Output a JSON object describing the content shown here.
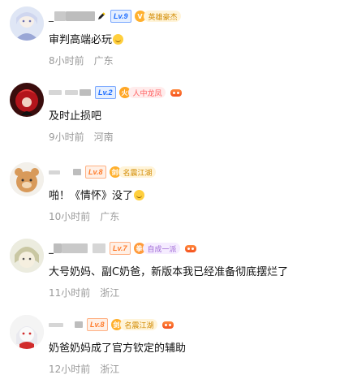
{
  "comments": [
    {
      "name": "_",
      "level": "Lv.9",
      "title_icon": "lightning-badge",
      "title": "英雄豪杰",
      "text": "审判高端必玩",
      "emoji": "smile-emoji",
      "time": "8小时前",
      "location": "广东"
    },
    {
      "name": "",
      "level": "Lv.2",
      "title_icon": "fire-badge",
      "title": "人中龙凤",
      "text": "及时止损吧",
      "time": "9小时前",
      "location": "河南"
    },
    {
      "name": "",
      "level": "Lv.8",
      "title_icon": "sword-badge",
      "title": "名震江湖",
      "text": "啪！《情怀》没了",
      "emoji": "smile-emoji",
      "time": "10小时前",
      "location": "广东"
    },
    {
      "name": "",
      "level": "Lv.7",
      "title_icon": "fist-badge",
      "title": "自成一派",
      "text": "大号奶妈、副C奶爸，新版本我已经准备彻底摆烂了",
      "time": "11小时前",
      "location": "浙江"
    },
    {
      "name": "",
      "level": "Lv.8",
      "title_icon": "sword-badge",
      "title": "名震江湖",
      "text": "奶爸奶妈成了官方钦定的辅助",
      "time": "12小时前",
      "location": "浙江"
    }
  ]
}
